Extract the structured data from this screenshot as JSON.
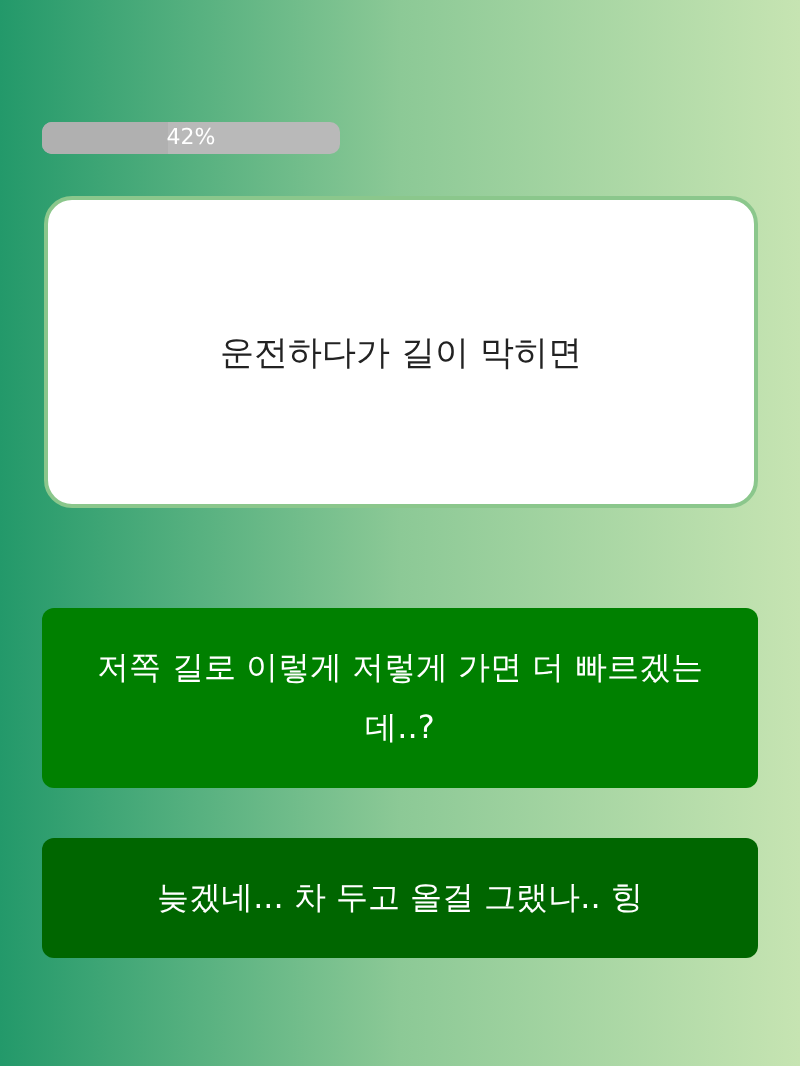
{
  "progress": {
    "label": "42%",
    "level": 0.42
  },
  "question": {
    "text": "운전하다가 길이 막히면"
  },
  "answers": [
    {
      "text": "저쪽 길로 이렇게 저렇게 가면 더 빠르겠는데..?",
      "selected": false
    },
    {
      "text": "늦겠네... 차 두고 올걸 그랬나.. 힝",
      "selected": true
    }
  ]
}
